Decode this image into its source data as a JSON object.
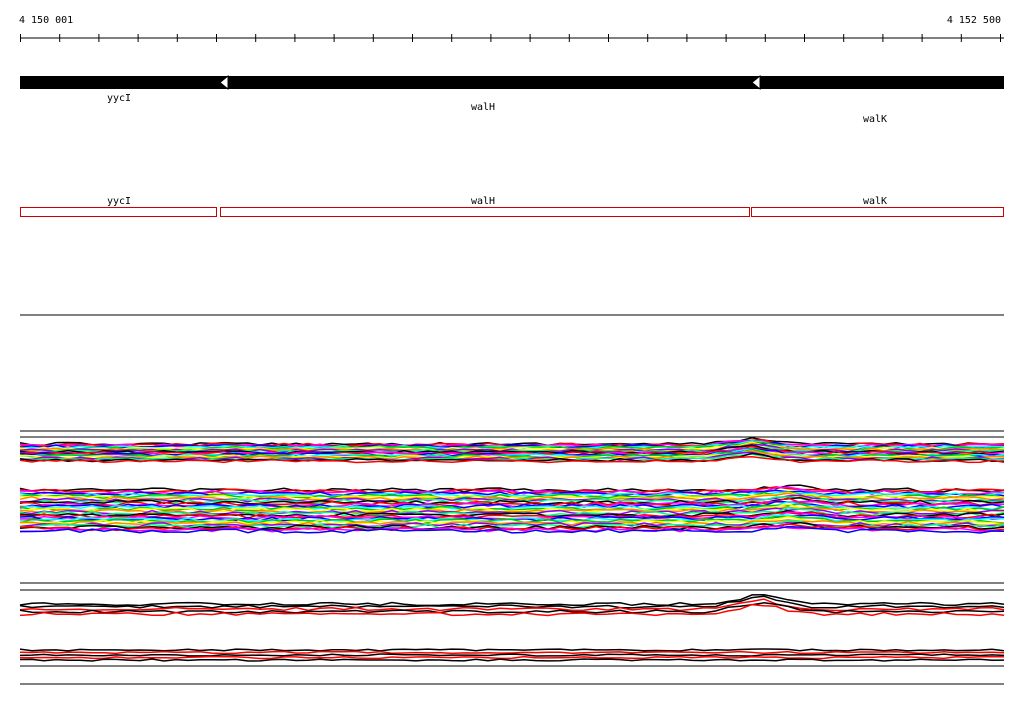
{
  "ruler": {
    "start_label": "4 150 001",
    "end_label": "4 152 500"
  },
  "genes": [
    {
      "name": "yycI",
      "strand": "-"
    },
    {
      "name": "walH",
      "strand": "-"
    },
    {
      "name": "walK",
      "strand": "-"
    }
  ],
  "annotation_labels": [
    {
      "name": "yycI"
    },
    {
      "name": "walH"
    },
    {
      "name": "walK"
    }
  ],
  "colors": {
    "gene_bar": "#000000",
    "annotation_box": "#cc0000",
    "profile_palette": [
      "#000000",
      "#ff0000",
      "#ff00ff",
      "#0000ff",
      "#00ffff",
      "#00cc00",
      "#ffff00",
      "#ff8800",
      "#8800ff",
      "#00ff88"
    ]
  }
}
